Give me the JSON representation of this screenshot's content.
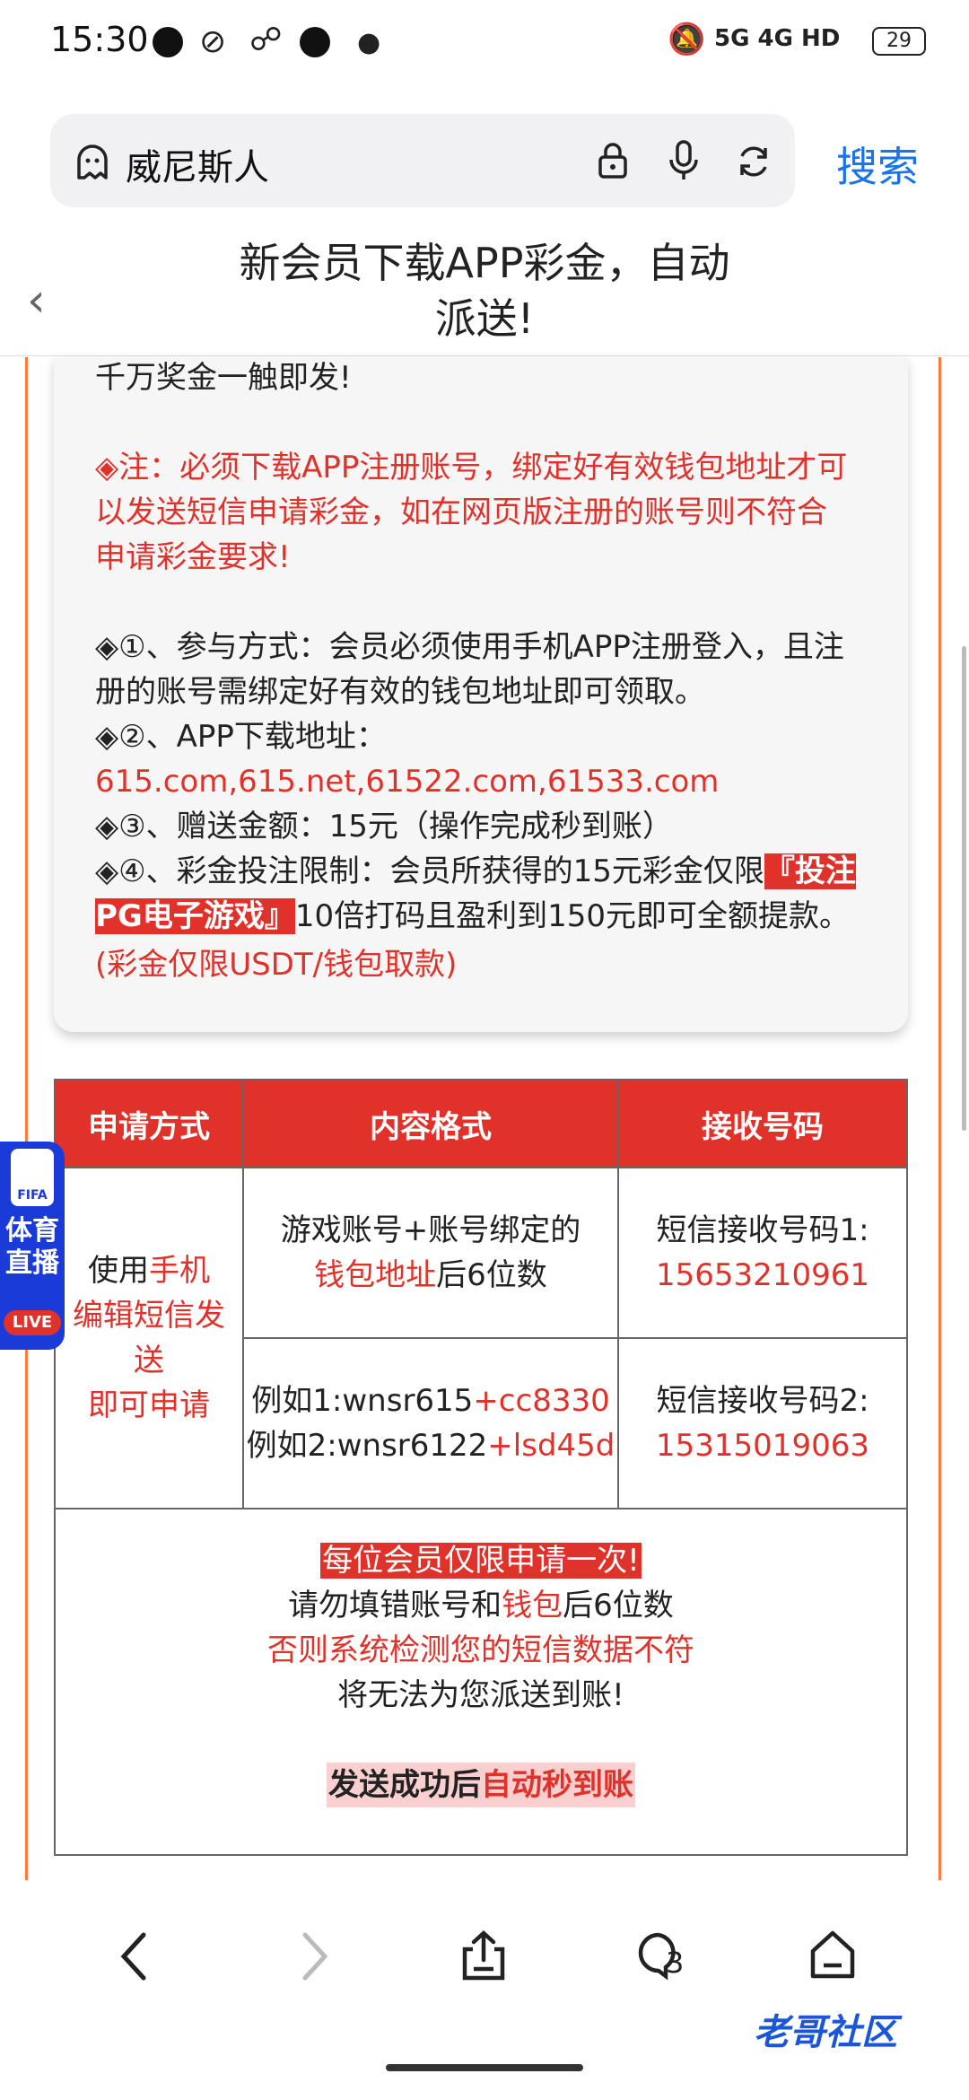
{
  "status": {
    "time": "15:30",
    "network": "5G 4G HD",
    "battery": "29"
  },
  "search": {
    "query": "威尼斯人",
    "button": "搜索"
  },
  "header": {
    "title_line1": "新会员下载APP彩金，自动",
    "title_line2": "派送!"
  },
  "content": {
    "line_top": "千万奖金一触即发!",
    "note_l1": "◈注：必须下载APP注册账号，绑定好有效钱包地址才可",
    "note_l2": "以发送短信申请彩金，如在网页版注册的账号则不符合",
    "note_l3": "申请彩金要求!",
    "i1_l1": "◈①、参与方式：会员必须使用手机APP注册登入，且注",
    "i1_l2": "册的账号需绑定好有效的钱包地址即可领取。",
    "i2": "◈②、APP下载地址：",
    "i2_url": "615.com,615.net,61522.com,61533.com",
    "i3": "◈③、赠送金额：15元（操作完成秒到账）",
    "i4_a": "◈④、彩金投注限制：会员所获得的15元彩金仅限",
    "i4_hl1": "『投注",
    "i4_hl2": "PG电子游戏』",
    "i4_b": "10倍打码且盈利到150元即可全额提款。",
    "i4_note": "(彩金仅限USDT/钱包取款)"
  },
  "table": {
    "headers": [
      "申请方式",
      "内容格式",
      "接收号码"
    ],
    "method": {
      "p1": "使用",
      "p2": "手机",
      "p3": "编辑短信发",
      "p4": "送",
      "p5": "即可申请"
    },
    "format1": {
      "l1": "游戏账号+账号绑定的",
      "l2_red": "钱包地址",
      "l2_rest": "后6位数"
    },
    "format2": {
      "ex1_a": "例如1:wnsr615",
      "ex1_b": "+cc8330",
      "ex2_a": "例如2:wnsr6122",
      "ex2_b": "+lsd45d"
    },
    "recv1": {
      "label": "短信接收号码1:",
      "number": "15653210961"
    },
    "recv2": {
      "label": "短信接收号码2:",
      "number": "15315019063"
    },
    "footer": {
      "f1": "每位会员仅限申请一次!",
      "f2_a": "请勿填错账号和",
      "f2_red": "钱包",
      "f2_b": "后6位数",
      "f3": "否则系统检测您的短信数据不符",
      "f4": "将无法为您派送到账!",
      "f5_a": "发送成功后",
      "f5_b": "自动秒到账"
    }
  },
  "badge": {
    "fifa": "FIFA",
    "l1": "体育",
    "l2": "直播",
    "live": "LIVE"
  },
  "nav": {
    "tabs_count": "3"
  },
  "watermark": "老哥社区",
  "colors": {
    "accent_red": "#e0322a",
    "link_blue": "#1a73e8",
    "badge_blue": "#1a3bd8"
  }
}
